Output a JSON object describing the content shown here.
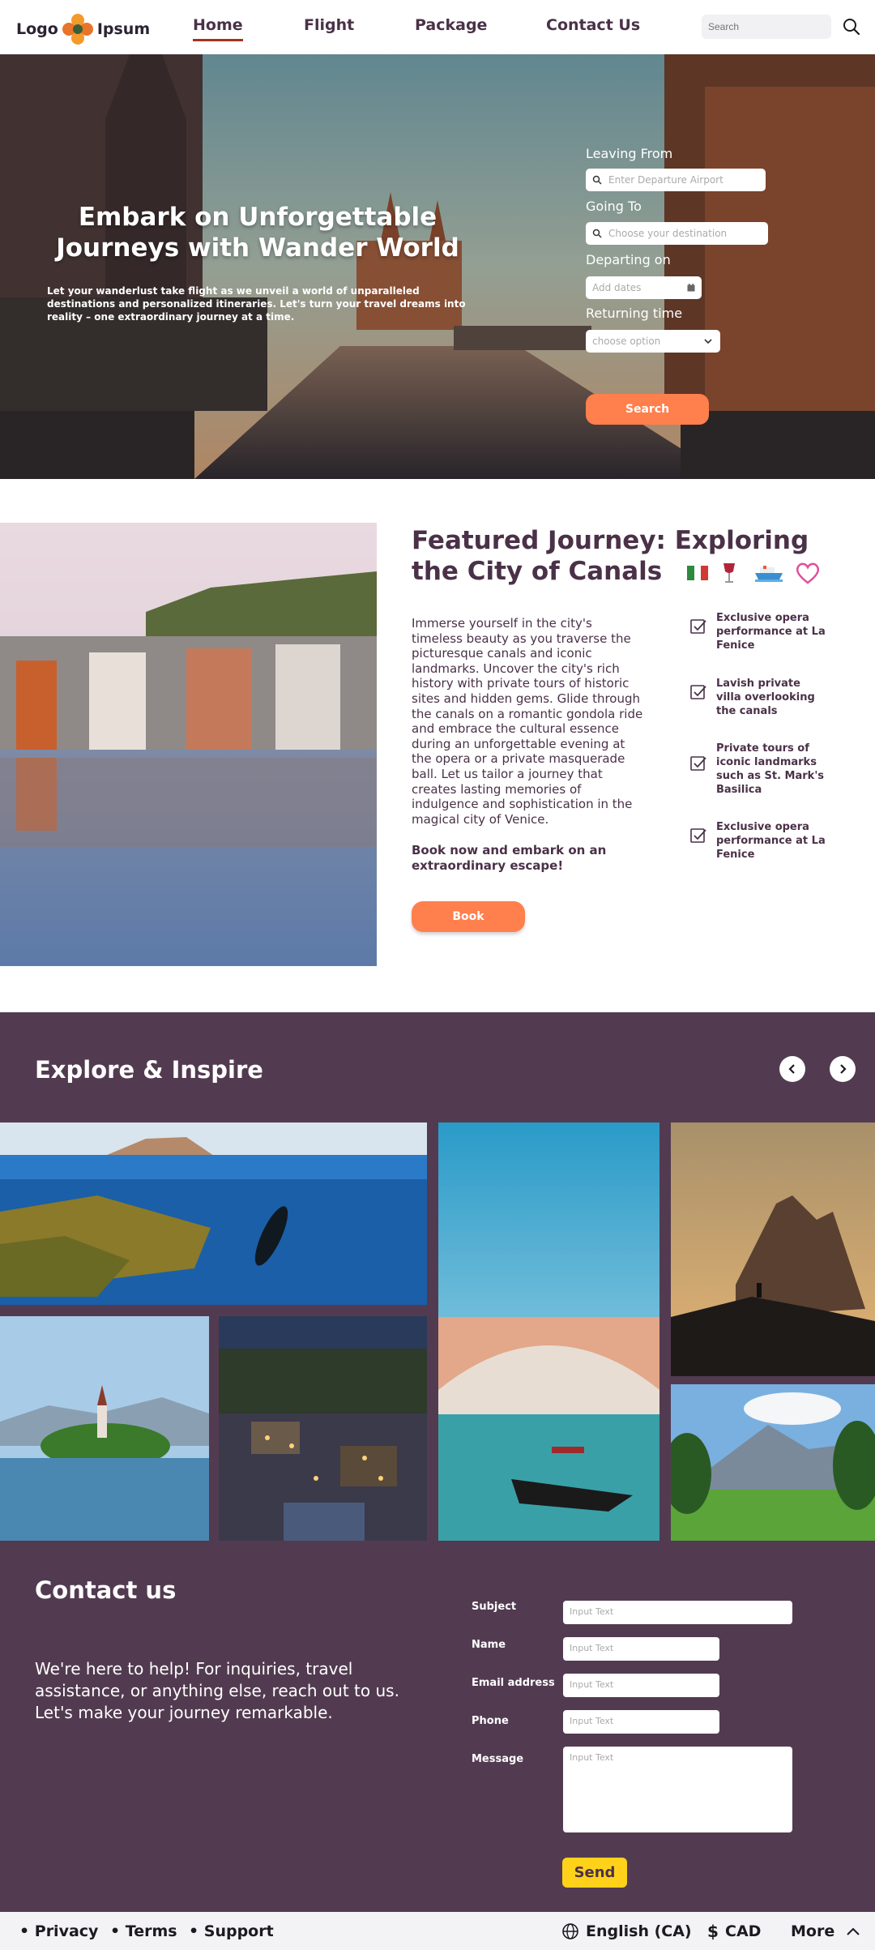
{
  "nav": {
    "logo_left": "Logo",
    "logo_right": "Ipsum",
    "links": [
      "Home",
      "Flight",
      "Package",
      "Contact Us"
    ],
    "search_placeholder": "Search"
  },
  "hero": {
    "title": "Embark on Unforgettable Journeys with Wander World",
    "subtitle": "Let your wanderlust take flight as we unveil a world of unparalleled destinations and personalized itineraries. Let's turn your travel dreams into reality – one extraordinary journey at a time.",
    "leaving_label": "Leaving From",
    "leaving_placeholder": "Enter Departure Airport",
    "going_label": "Going To",
    "going_placeholder": "Choose your destination",
    "departing_label": "Departing on",
    "departing_placeholder": "Add dates",
    "returning_label": "Returning time",
    "returning_option": "choose option",
    "search_button": "Search"
  },
  "featured": {
    "title": "Featured Journey: Exploring the City of Canals",
    "body": "Immerse yourself in the city's timeless beauty as you traverse the picturesque canals and iconic landmarks. Uncover the city's rich history with private tours of historic sites and hidden gems. Glide through the canals on a romantic gondola ride and embrace the cultural essence during an unforgettable evening at the opera or a private masquerade ball. Let us tailor a journey that creates lasting memories of indulgence and sophistication in the magical city of Venice.",
    "cta": "Book now and embark on an extraordinary escape!",
    "book_button": "Book",
    "checks": [
      "Exclusive opera performance at La Fenice",
      "Lavish private villa overlooking the canals",
      "Private tours of iconic landmarks such as St. Mark's Basilica",
      "Exclusive opera performance at La Fenice"
    ]
  },
  "explore": {
    "title": "Explore & Inspire"
  },
  "contact": {
    "title": "Contact us",
    "body": "We're here to help! For inquiries, travel assistance, or anything else, reach out to us. Let's make your journey remarkable.",
    "labels": [
      "Subject",
      "Name",
      "Email address",
      "Phone",
      "Message"
    ],
    "placeholder": "Input Text",
    "send_button": "Send"
  },
  "footer": {
    "links": [
      "Privacy",
      "Terms",
      "Support"
    ],
    "language": "English (CA)",
    "currency": "CAD",
    "more": "More"
  },
  "colors": {
    "accent": "#ff7f4d",
    "purple": "#523b50",
    "text": "#4a3148",
    "send": "#ffd11a"
  }
}
